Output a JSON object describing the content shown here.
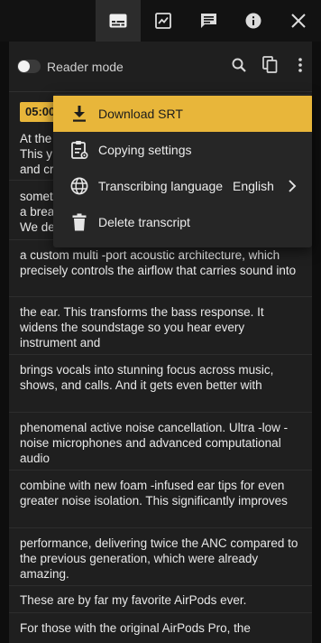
{
  "tabs": [
    {
      "icon": "subtitles-icon",
      "active": true
    },
    {
      "icon": "chart-icon",
      "active": false
    },
    {
      "icon": "chat-icon",
      "active": false
    },
    {
      "icon": "info-icon",
      "active": false
    },
    {
      "icon": "close-icon",
      "active": false
    }
  ],
  "header": {
    "reader_mode_label": "Reader mode",
    "reader_mode_on": false,
    "icons": [
      "search-icon",
      "copy-icon",
      "more-vert-icon"
    ]
  },
  "transcript": {
    "first_timestamp": "05:00",
    "segments": [
      {
        "text": "At the\nThis y\nand cr"
      },
      {
        "text": "somet\na brea\nWe de"
      },
      {
        "text": "a custom multi -port acoustic architecture, which precisely controls the airflow that carries sound into"
      },
      {
        "text": "the ear. This transforms the bass response. It widens the soundstage so you hear every instrument and"
      },
      {
        "text": "brings vocals into stunning focus across music, shows, and calls. And it gets even better with"
      },
      {
        "text": "phenomenal active noise cancellation. Ultra -low -noise microphones and advanced computational audio"
      },
      {
        "text": "combine with new foam -infused ear tips for even greater noise isolation. This significantly improves"
      },
      {
        "text": "performance, delivering twice the ANC compared to the previous generation, which were already amazing."
      },
      {
        "text": "These are by far my favorite AirPods ever."
      },
      {
        "text": "For those with the original AirPods Pro, the"
      }
    ]
  },
  "menu": {
    "items": [
      {
        "label": "Download SRT",
        "icon": "download-icon",
        "highlighted": true
      },
      {
        "label": "Copying settings",
        "icon": "clipboard-settings-icon",
        "highlighted": false
      },
      {
        "label": "Transcribing language",
        "value": "English",
        "icon": "globe-icon",
        "highlighted": false
      },
      {
        "label": "Delete transcript",
        "icon": "trash-icon",
        "highlighted": false
      }
    ]
  },
  "colors": {
    "accent": "#e8b63a",
    "panel_bg": "#1f1f1f",
    "menu_bg": "#262626"
  }
}
